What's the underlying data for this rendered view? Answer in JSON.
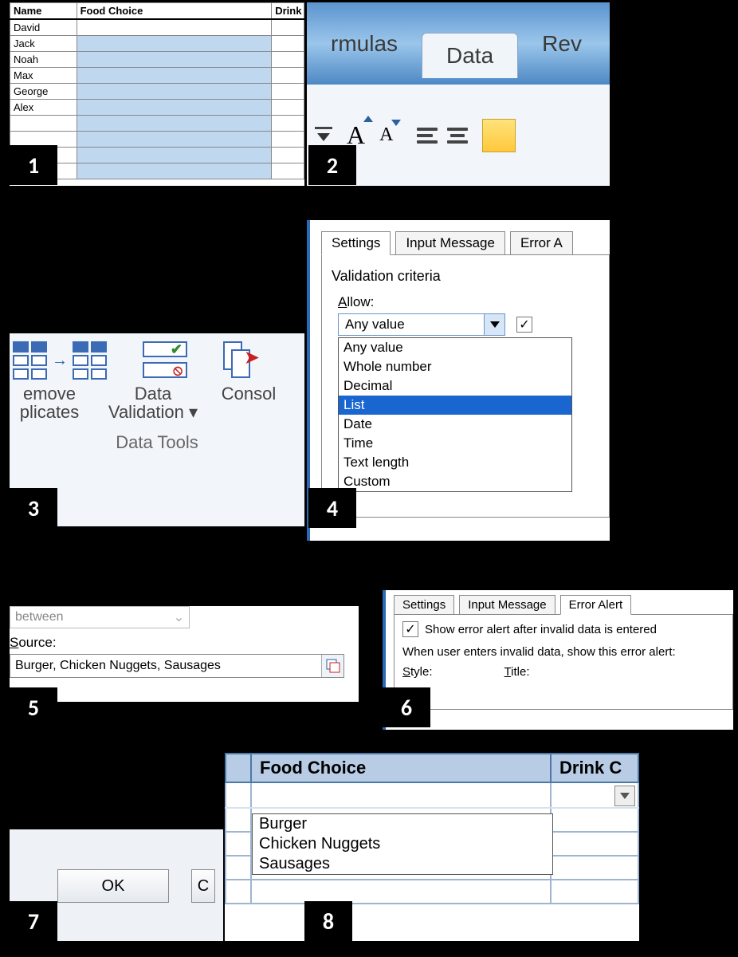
{
  "panel1": {
    "headers": [
      "Name",
      "Food Choice",
      "Drink"
    ],
    "names": [
      "David",
      "Jack",
      "Noah",
      "Max",
      "George",
      "Alex"
    ]
  },
  "panel2": {
    "tabs": {
      "left": "rmulas",
      "active": "Data",
      "right": "Rev"
    }
  },
  "panel3": {
    "removeDup": "emove\nplicates",
    "dataVal": "Data\nValidation",
    "consol": "Consol",
    "group": "Data Tools"
  },
  "panel4": {
    "tabs": [
      "Settings",
      "Input Message",
      "Error A"
    ],
    "criteriaTitle": "Validation criteria",
    "allowLabelPrefix": "A",
    "allowLabelRest": "llow:",
    "allowValue": "Any value",
    "options": [
      "Any value",
      "Whole number",
      "Decimal",
      "List",
      "Date",
      "Time",
      "Text length",
      "Custom"
    ],
    "highlighted": "List"
  },
  "panel5": {
    "dataMode": "between",
    "sourceLabelPrefix": "S",
    "sourceLabelRest": "ource:",
    "sourceValue": "Burger, Chicken Nuggets, Sausages"
  },
  "panel6": {
    "tabs": [
      "Settings",
      "Input Message",
      "Error Alert"
    ],
    "chkLabel": "Show error alert after invalid data is entered",
    "sentence": "When user enters invalid data, show this error alert:",
    "styleLabelPrefix": "S",
    "styleLabelRest": "tyle:",
    "titleLabelPrefix": "T",
    "titleLabelRest": "itle:"
  },
  "panel7": {
    "ok": "OK",
    "cancelFrag": "C"
  },
  "panel8": {
    "headers": [
      "Food Choice",
      "Drink C"
    ],
    "options": [
      "Burger",
      "Chicken Nuggets",
      "Sausages"
    ]
  },
  "labels": {
    "1": "1",
    "2": "2",
    "3": "3",
    "4": "4",
    "5": "5",
    "6": "6",
    "7": "7",
    "8": "8"
  }
}
